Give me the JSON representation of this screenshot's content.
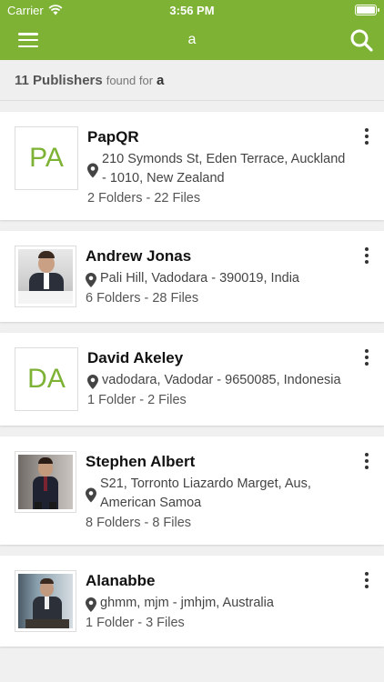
{
  "status": {
    "carrier": "Carrier",
    "time": "3:56 PM"
  },
  "nav": {
    "title": "a",
    "menu_icon": "hamburger-icon",
    "search_icon": "search-icon"
  },
  "summary": {
    "count": "11 Publishers",
    "middle": "found for",
    "query": "a"
  },
  "colors": {
    "brand": "#7db235"
  },
  "publishers": [
    {
      "initials": "PA",
      "name": "PapQR",
      "address": "210 Symonds St, Eden Terrace, Auckland - 1010, New Zealand",
      "meta": "2 Folders - 22 Files"
    },
    {
      "initials": "",
      "name": "Andrew Jonas",
      "address": "Pali Hill, Vadodara - 390019, India",
      "meta": "6 Folders - 28 Files"
    },
    {
      "initials": "DA",
      "name": "David Akeley",
      "address": "vadodara, Vadodar - 9650085, Indonesia",
      "meta": "1 Folder - 2 Files"
    },
    {
      "initials": "",
      "name": "Stephen Albert",
      "address": "S21, Torronto Liazardo Marget, Aus, American Samoa",
      "meta": "8 Folders - 8 Files"
    },
    {
      "initials": "",
      "name": "Alanabbe",
      "address": "ghmm, mjm - jmhjm, Australia",
      "meta": "1 Folder - 3 Files"
    }
  ]
}
